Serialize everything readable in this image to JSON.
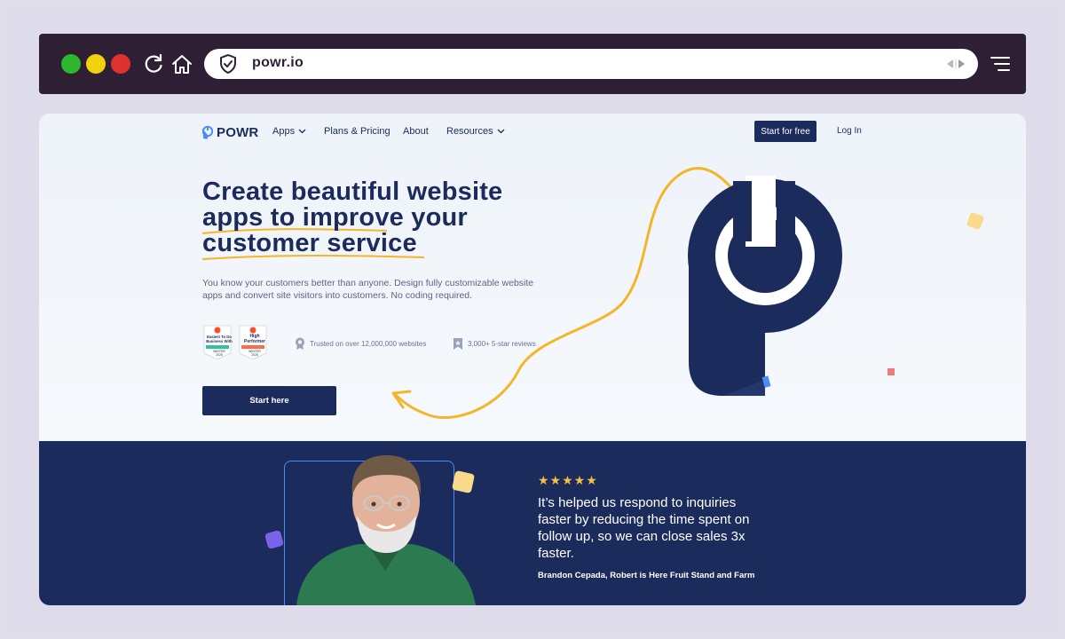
{
  "browser": {
    "url": "powr.io"
  },
  "site": {
    "logo_text": "POWR",
    "nav": {
      "apps": "Apps",
      "plans": "Plans & Pricing",
      "about": "About",
      "resources": "Resources"
    },
    "start_free": "Start for free",
    "login": "Log In"
  },
  "hero": {
    "headline_line1": "Create beautiful website",
    "headline_line2": "apps to improve your",
    "headline_line3": "customer service",
    "subtext": "You know your customers better than anyone. Design fully customizable website apps and convert site visitors into customers. No coding required.",
    "badge1": {
      "line1": "Easiest To Do",
      "line2": "Business With",
      "season": "WINTER",
      "year": "2025"
    },
    "badge2": {
      "line1": "High",
      "line2": "Performer",
      "season": "WINTER",
      "year": "2025"
    },
    "stat1": "Trusted on over 12,000,000 websites",
    "stat2": "3,000+ 5-star reviews",
    "cta": "Start here"
  },
  "testimonial": {
    "stars": "★★★★★",
    "quote": "It’s helped us respond to inquiries faster by reducing the time spent on follow up, so we can close sales 3x faster.",
    "author": "Brandon Cepada, Robert is Here Fruit Stand and Farm"
  },
  "colors": {
    "navy": "#1b2b5b",
    "browser_bar": "#2f1f35",
    "accent_yellow": "#f5b52a",
    "frame_bg": "#e0ddeb"
  }
}
